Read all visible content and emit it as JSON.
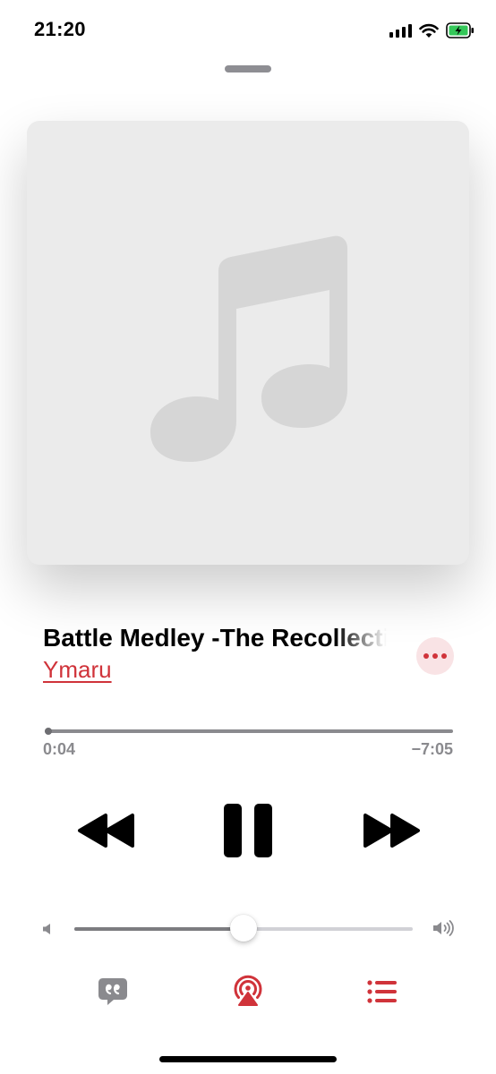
{
  "status_bar": {
    "time": "21:20",
    "icons": [
      "cellular-signal-icon",
      "wifi-icon",
      "battery-charging-icon"
    ]
  },
  "player": {
    "artwork_icon": "music-note-icon",
    "track_title": "Battle Medley -The Recollection-",
    "artist": "Ymaru",
    "elapsed": "0:04",
    "remaining": "−7:05",
    "progress_fraction": 0.009,
    "volume_fraction": 0.5,
    "is_playing": true
  },
  "controls": {
    "transport": [
      "rewind-icon",
      "pause-icon",
      "fast-forward-icon"
    ],
    "toolbar": [
      "lyrics-icon",
      "airplay-icon",
      "queue-icon"
    ]
  },
  "colors": {
    "accent": "#d0333a",
    "accent_tint": "#f9e3e5",
    "secondary_text": "#8a8a8e",
    "artwork_bg": "#ebebeb",
    "artwork_glyph": "#d6d6d6"
  }
}
